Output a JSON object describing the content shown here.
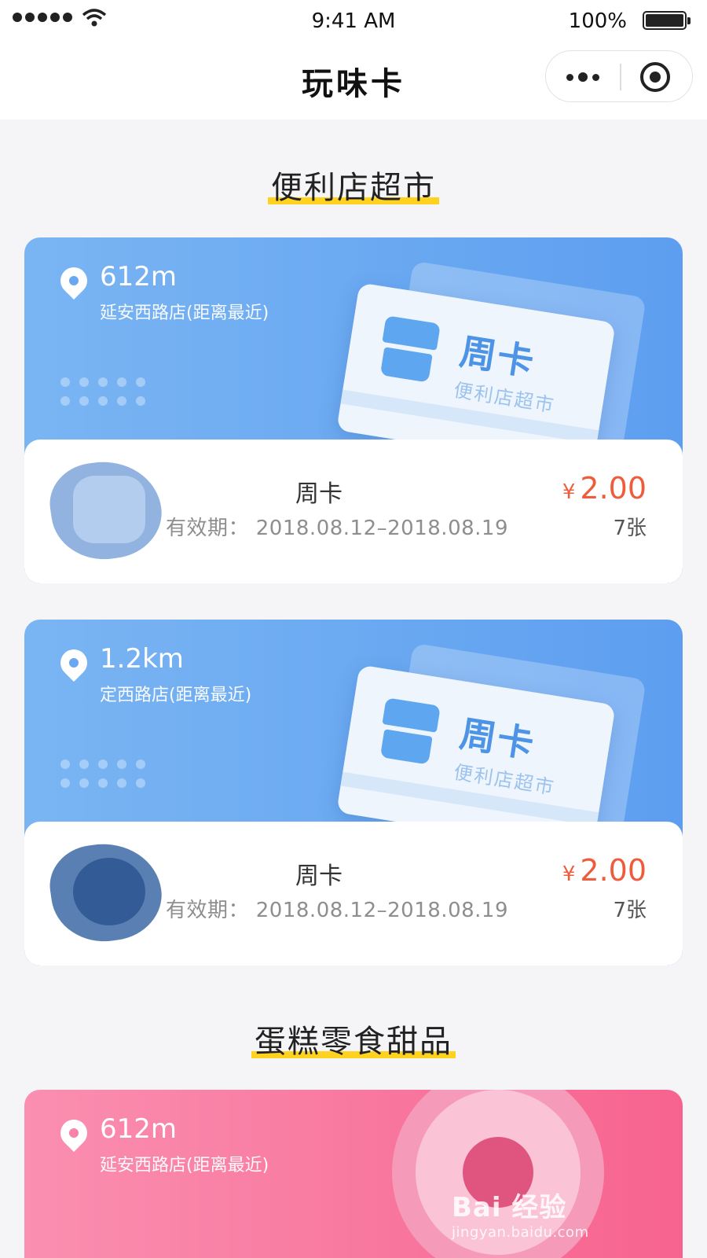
{
  "status_bar": {
    "time": "9:41 AM",
    "battery": "100%"
  },
  "nav": {
    "title": "玩味卡"
  },
  "sections": [
    {
      "title": "便利店超市",
      "cards": [
        {
          "distance": "612m",
          "store": "延安西路店(距离最近)",
          "ticket_title": "周卡",
          "ticket_subtitle": "便利店超市",
          "name": "周卡",
          "validity": "有效期：  2018.08.12–2018.08.19",
          "currency": "¥",
          "price": "2.00",
          "count": "7张"
        },
        {
          "distance": "1.2km",
          "store": "定西路店(距离最近)",
          "ticket_title": "周卡",
          "ticket_subtitle": "便利店超市",
          "name": "周卡",
          "validity": "有效期：  2018.08.12–2018.08.19",
          "currency": "¥",
          "price": "2.00",
          "count": "7张"
        }
      ]
    },
    {
      "title": "蛋糕零食甜品",
      "cards": [
        {
          "distance": "612m",
          "store": "延安西路店(距离最近)"
        }
      ]
    }
  ],
  "watermark": {
    "logo": "Bai 经验",
    "url": "jingyan.baidu.com"
  },
  "colors": {
    "accent_yellow": "#ffd21f",
    "price_red": "#ef5c3c",
    "card_blue": "#5d9ef0",
    "card_pink": "#f7638f"
  }
}
